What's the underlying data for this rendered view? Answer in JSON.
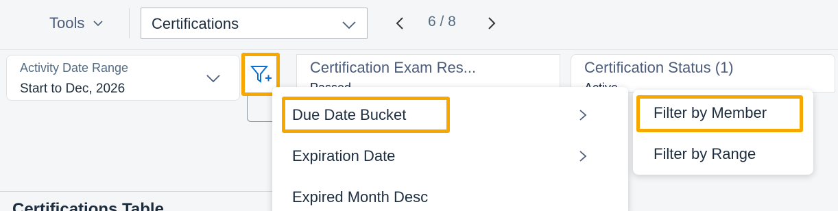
{
  "toolbar": {
    "tools_label": "Tools",
    "page_select_value": "Certifications",
    "pager_text": "6 / 8"
  },
  "filters": {
    "date_range": {
      "label": "Activity Date Range",
      "value": "Start to Dec, 2026"
    },
    "exam_result": {
      "label": "Certification Exam Res...",
      "value": "Passed"
    },
    "status": {
      "label": "Certification Status (1)",
      "value": "Active"
    }
  },
  "menu": {
    "items": [
      {
        "label": "Due Date Bucket",
        "has_submenu": true
      },
      {
        "label": "Expiration Date",
        "has_submenu": true
      },
      {
        "label": "Expired Month Desc",
        "has_submenu": false
      }
    ]
  },
  "submenu": {
    "items": [
      {
        "label": "Filter by Member"
      },
      {
        "label": "Filter by Range"
      }
    ]
  },
  "section": {
    "title": "Certifications Table"
  },
  "colors": {
    "accent": "#0a6ed1",
    "highlight": "#f6a800",
    "text": "#1d2d3e",
    "muted": "#556b82"
  },
  "icons": {
    "tools_caret": "chevron-down-icon",
    "select_caret": "chevron-down-icon",
    "pager_prev": "chevron-left-icon",
    "pager_next": "chevron-right-icon",
    "add_filter": "filter-add-icon",
    "submenu_chevron": "chevron-right-icon"
  }
}
